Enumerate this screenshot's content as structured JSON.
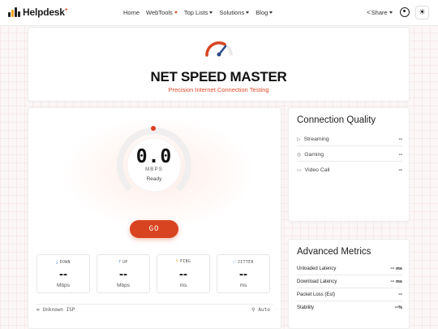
{
  "app": {
    "logo_text": "Helpdesk",
    "logo_mark": "+"
  },
  "nav": {
    "items": [
      {
        "label": "Home",
        "dropdown": false,
        "active": false
      },
      {
        "label": "WebTools",
        "dropdown": true,
        "active": true
      },
      {
        "label": "Top Lists",
        "dropdown": true,
        "active": false
      },
      {
        "label": "Solutions",
        "dropdown": true,
        "active": false
      },
      {
        "label": "Blog",
        "dropdown": true,
        "active": false
      }
    ],
    "share_label": "Share",
    "theme_icon": "sun-icon"
  },
  "header": {
    "title": "NET SPEED MASTER",
    "subtitle": "Precision Internet Connection Testing"
  },
  "test": {
    "speed": "0.0",
    "unit": "MBPS",
    "status": "Ready",
    "go_label": "GO",
    "metrics": [
      {
        "label": "DOWN",
        "icon": "download-icon",
        "value": "--",
        "unit": "Mbps"
      },
      {
        "label": "UP",
        "icon": "upload-icon",
        "value": "--",
        "unit": "Mbps"
      },
      {
        "label": "PING",
        "icon": "bolt-icon",
        "value": "--",
        "unit": "ms"
      },
      {
        "label": "JITTER",
        "icon": "chart-icon",
        "value": "--",
        "unit": "ms"
      }
    ],
    "isp": "Unknown ISP",
    "location": "Auto"
  },
  "connection_quality": {
    "title": "Connection Quality",
    "rows": [
      {
        "label": "Streaming",
        "icon": "play-icon",
        "value": "--"
      },
      {
        "label": "Gaming",
        "icon": "gamepad-icon",
        "value": "--"
      },
      {
        "label": "Video Call",
        "icon": "video-icon",
        "value": "--"
      }
    ]
  },
  "advanced_metrics": {
    "title": "Advanced Metrics",
    "rows": [
      {
        "label": "Unloaded Latency",
        "value": "--",
        "unit": "ms"
      },
      {
        "label": "Download Latency",
        "value": "--",
        "unit": "ms"
      },
      {
        "label": "Packet Loss (Est)",
        "value": "--",
        "unit": ""
      },
      {
        "label": "Stability",
        "value": "--",
        "unit": "%"
      }
    ]
  },
  "colors": {
    "accent": "#d84420",
    "brand_orange": "#f2a51f",
    "blue": "#3a78c8"
  }
}
